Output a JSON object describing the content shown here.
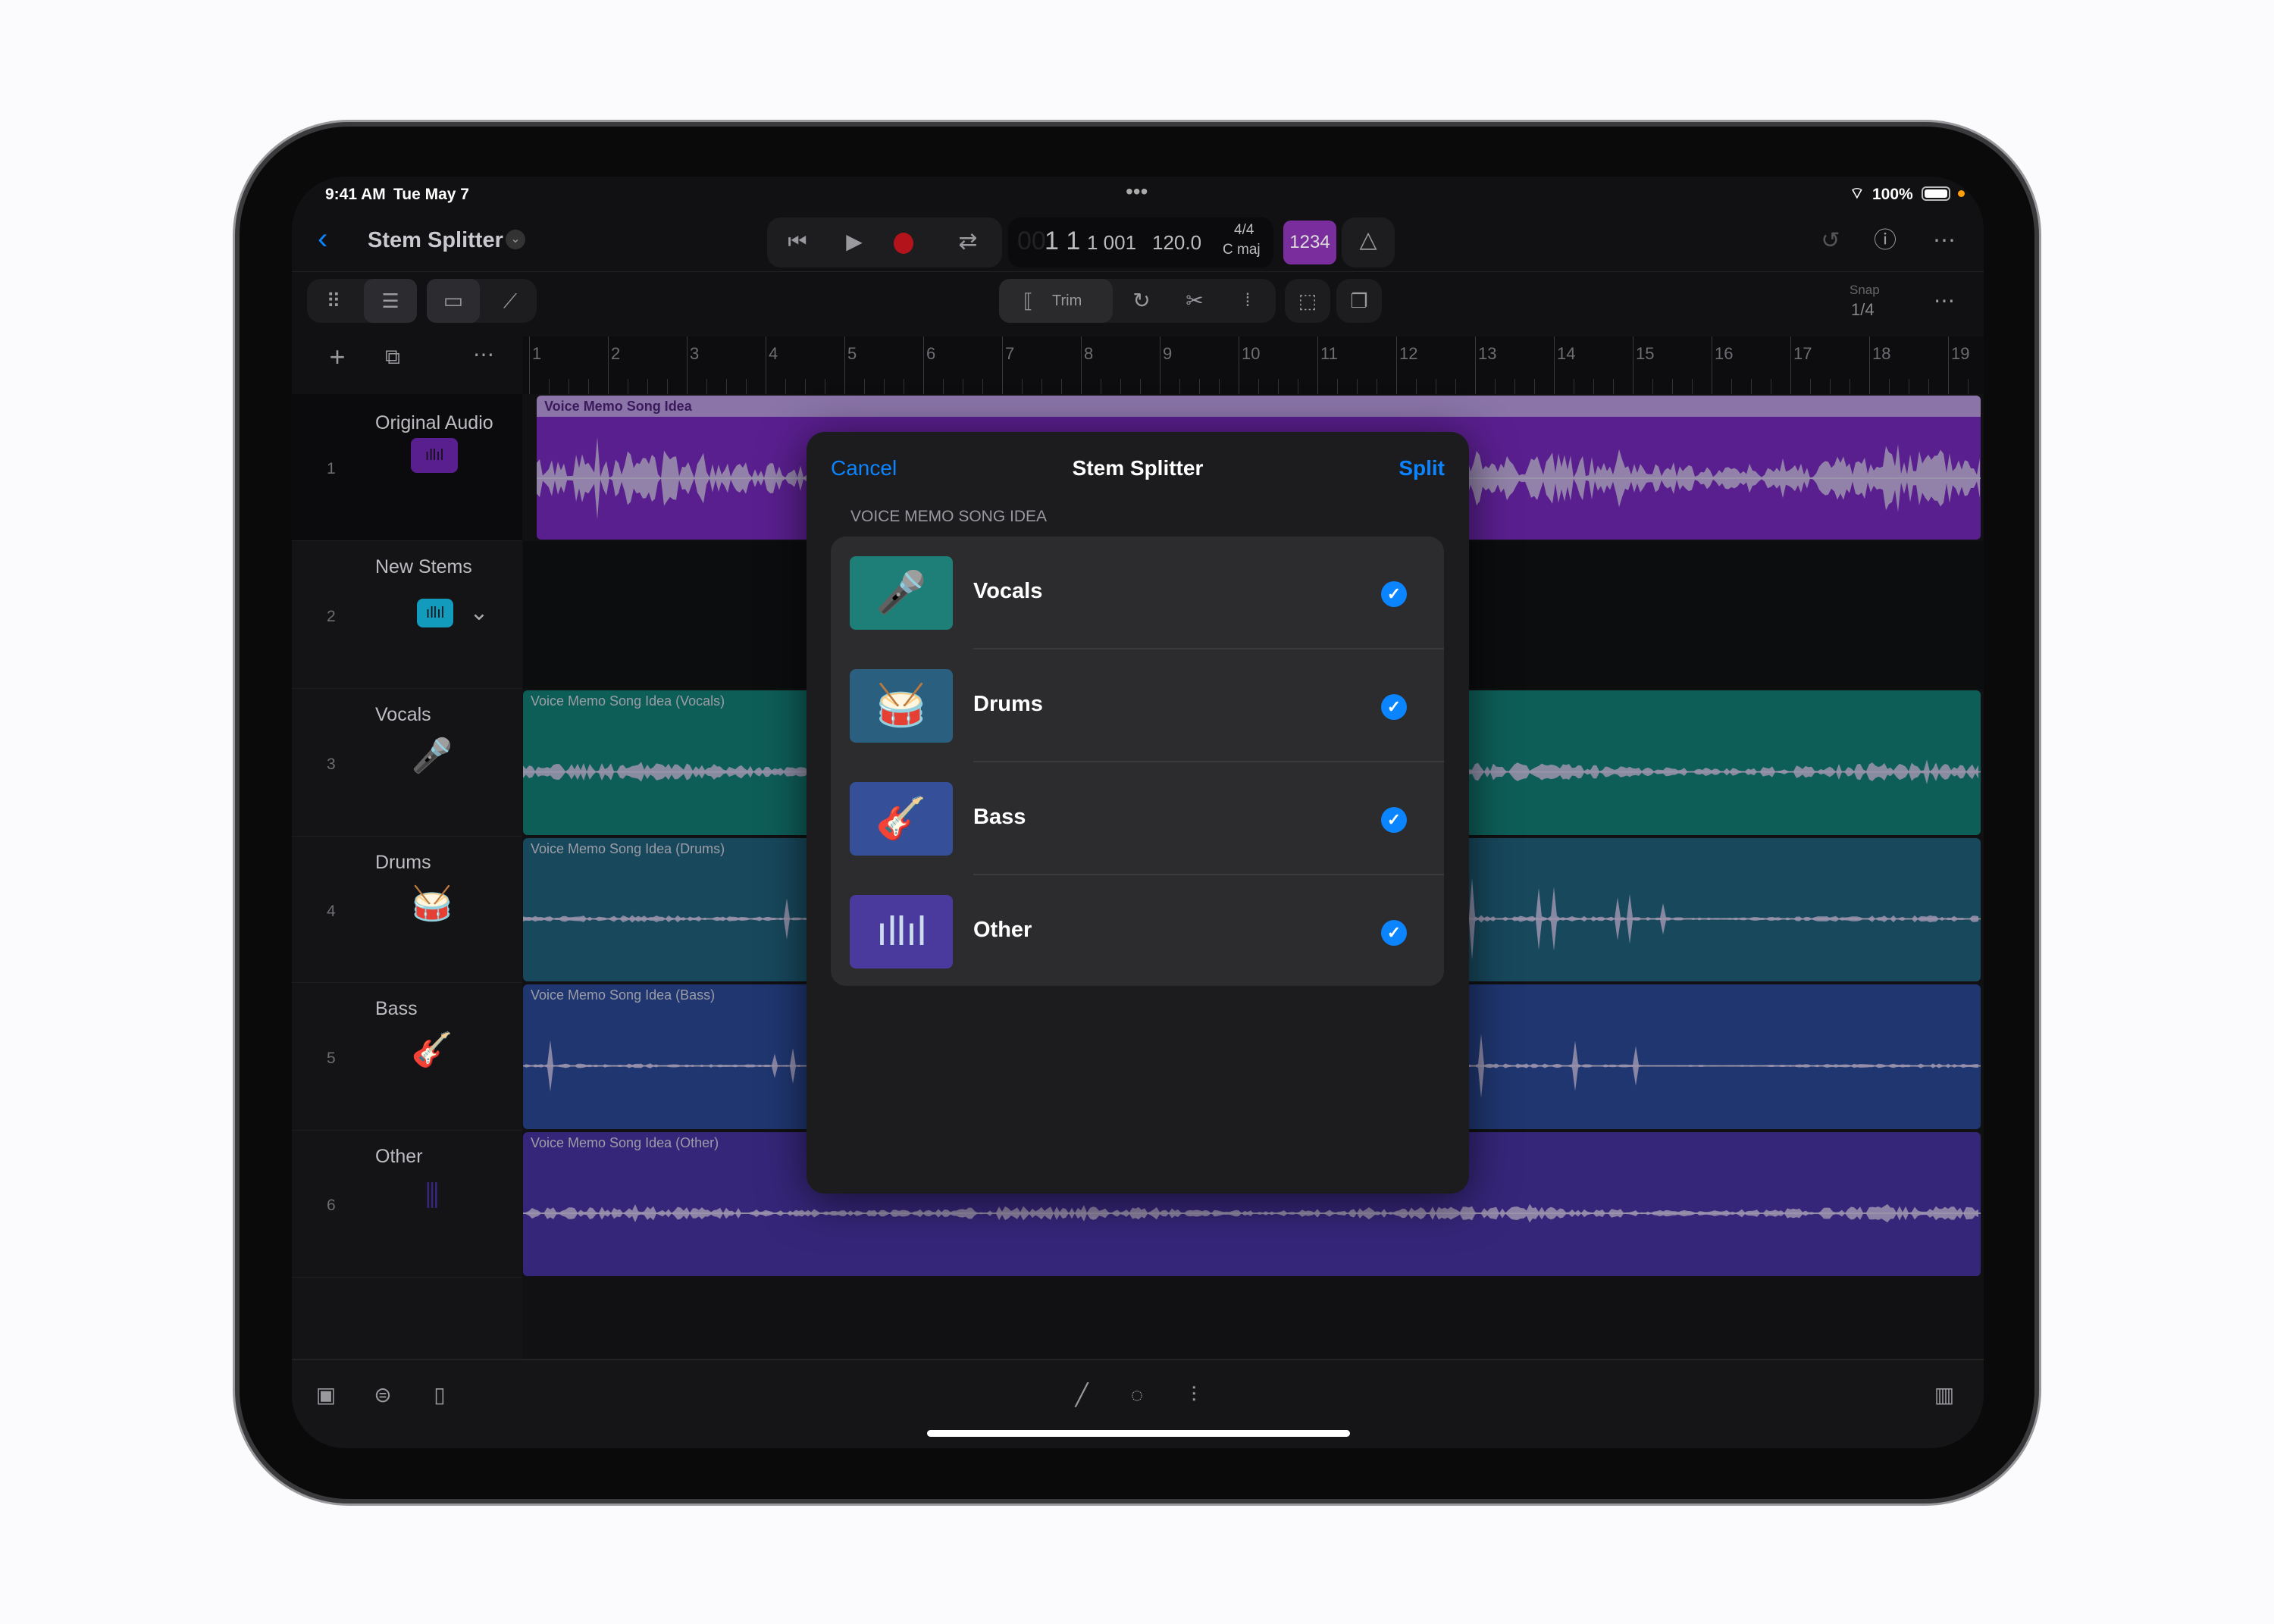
{
  "status": {
    "time": "9:41 AM",
    "date": "Tue May 7",
    "battery": "100%"
  },
  "nav": {
    "title": "Stem Splitter",
    "position_dim": "00",
    "position": "1 1",
    "beat": "1 001",
    "tempo": "120.0",
    "signature": "4/4",
    "key": "C maj",
    "count_in": "1234"
  },
  "toolbar": {
    "trim_label": "Trim",
    "snap_label": "Snap",
    "snap_value": "1/4"
  },
  "ruler": [
    "1",
    "2",
    "3",
    "4",
    "5",
    "6",
    "7",
    "8",
    "9",
    "10",
    "11",
    "12",
    "13",
    "14",
    "15",
    "16",
    "17",
    "18",
    "19"
  ],
  "tracks": [
    {
      "number": "1",
      "name": "Original Audio",
      "region": "Voice Memo Song Idea",
      "color": "#5a1f8f"
    },
    {
      "number": "2",
      "name": "New Stems",
      "region": "",
      "color": "#139bbd"
    },
    {
      "number": "3",
      "name": "Vocals",
      "region": "Voice Memo Song Idea (Vocals)",
      "color": "#0e5e58"
    },
    {
      "number": "4",
      "name": "Drums",
      "region": "Voice Memo Song Idea (Drums)",
      "color": "#17485c"
    },
    {
      "number": "5",
      "name": "Bass",
      "region": "Voice Memo Song Idea (Bass)",
      "color": "#1f3670"
    },
    {
      "number": "6",
      "name": "Other",
      "region": "Voice Memo Song Idea (Other)",
      "color": "#36267a"
    }
  ],
  "dialog": {
    "cancel": "Cancel",
    "title": "Stem Splitter",
    "split": "Split",
    "section": "VOICE MEMO SONG IDEA",
    "stems": [
      {
        "label": "Vocals",
        "icon": "microphone-icon",
        "color": "#1e7f78",
        "checked": true
      },
      {
        "label": "Drums",
        "icon": "drum-kit-icon",
        "color": "#2a5f80",
        "checked": true
      },
      {
        "label": "Bass",
        "icon": "bass-guitar-icon",
        "color": "#354f98",
        "checked": true
      },
      {
        "label": "Other",
        "icon": "waveform-icon",
        "color": "#4b3a9e",
        "checked": true
      }
    ]
  },
  "colors": {
    "accent": "#0a84ff",
    "record": "#b3141b",
    "count_in": "#7a2d9c"
  }
}
